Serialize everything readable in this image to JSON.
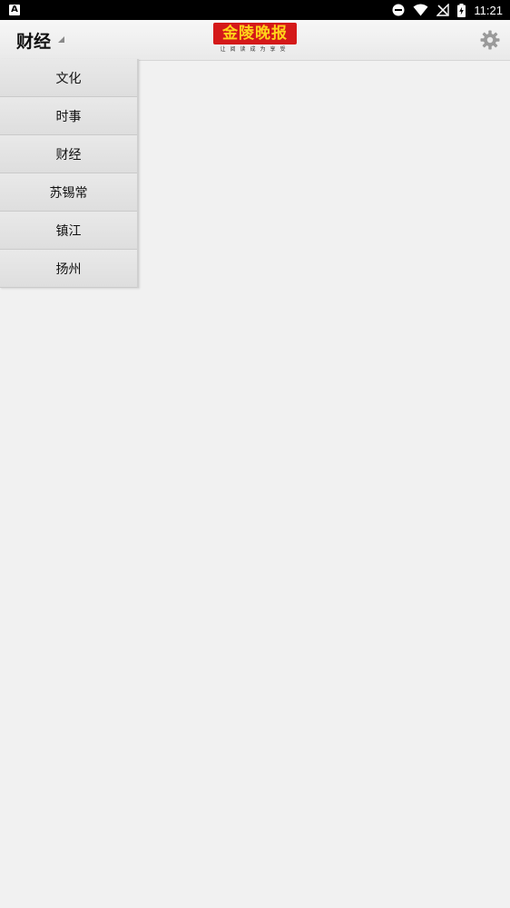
{
  "status_bar": {
    "left_icon": "A",
    "time": "11:21",
    "icons": [
      "do-not-disturb-icon",
      "wifi-icon",
      "no-signal-icon",
      "battery-charging-icon"
    ]
  },
  "header": {
    "title": "财经",
    "logo_text": "金陵晚报",
    "logo_tagline": "让阅读成为享受",
    "logo_colors": {
      "background": "#d41919",
      "text": "#ffd31a"
    },
    "settings_icon": "gear-icon"
  },
  "menu": {
    "items": [
      {
        "label": "文化"
      },
      {
        "label": "时事"
      },
      {
        "label": "财经"
      },
      {
        "label": "苏锡常"
      },
      {
        "label": "镇江"
      },
      {
        "label": "扬州"
      }
    ]
  }
}
